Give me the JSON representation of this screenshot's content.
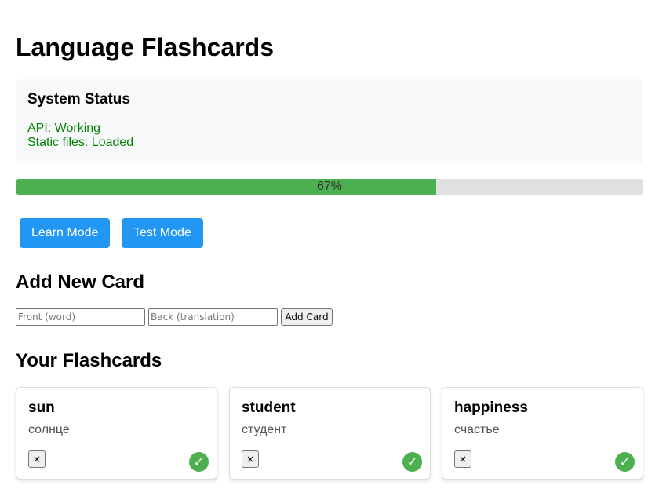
{
  "page": {
    "title": "Language Flashcards"
  },
  "status": {
    "heading": "System Status",
    "api": "API: Working",
    "static_files": "Static files: Loaded",
    "ok_color": "#008000"
  },
  "progress": {
    "value": 0.67,
    "label": "67%",
    "fill_color": "#4caf50"
  },
  "modes": {
    "learn_label": "Learn Mode",
    "test_label": "Test Mode",
    "color": "#2196f3"
  },
  "add_card": {
    "heading": "Add New Card",
    "front_placeholder": "Front (word)",
    "back_placeholder": "Back (translation)",
    "front_value": "",
    "back_value": "",
    "button_label": "Add Card"
  },
  "flashcards": {
    "heading": "Your Flashcards",
    "cards": [
      {
        "front": "sun",
        "back": "солнце",
        "delete_label": "×",
        "learned_icon": "✓"
      },
      {
        "front": "student",
        "back": "студент",
        "delete_label": "×",
        "learned_icon": "✓"
      },
      {
        "front": "happiness",
        "back": "счастье",
        "delete_label": "×",
        "learned_icon": "✓"
      }
    ]
  }
}
